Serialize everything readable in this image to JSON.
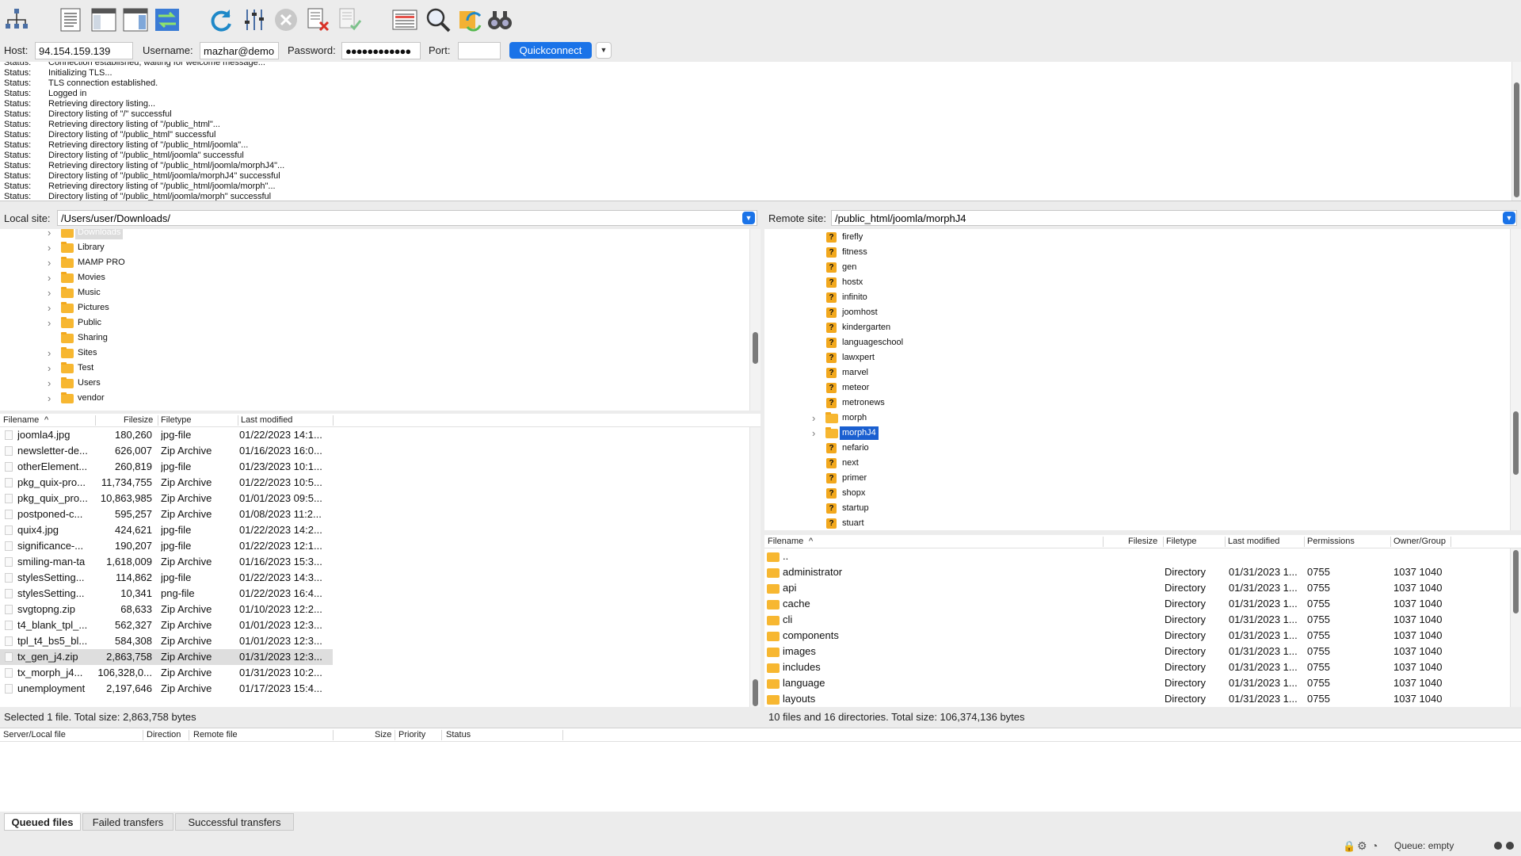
{
  "toolbar": {
    "icons": [
      "site-manager-icon",
      "message-log-icon",
      "local-tree-icon",
      "remote-tree-icon",
      "transfer-queue-icon",
      "refresh-icon",
      "filter-icon",
      "cancel-icon",
      "disconnect-icon",
      "reconnect-icon",
      "directory-comparison-icon",
      "search-icon",
      "sync-browse-icon",
      "find-files-icon"
    ]
  },
  "quickconnect": {
    "host_label": "Host:",
    "host_value": "94.154.159.139",
    "username_label": "Username:",
    "username_value": "mazhar@demo.",
    "password_label": "Password:",
    "password_value": "●●●●●●●●●●●●",
    "port_label": "Port:",
    "port_value": "",
    "button_label": "Quickconnect",
    "dropdown_glyph": "▼"
  },
  "log": [
    {
      "type": "Status:",
      "msg": "Connection established, waiting for welcome message..."
    },
    {
      "type": "Status:",
      "msg": "Initializing TLS..."
    },
    {
      "type": "Status:",
      "msg": "TLS connection established."
    },
    {
      "type": "Status:",
      "msg": "Logged in"
    },
    {
      "type": "Status:",
      "msg": "Retrieving directory listing..."
    },
    {
      "type": "Status:",
      "msg": "Directory listing of \"/\" successful"
    },
    {
      "type": "Status:",
      "msg": "Retrieving directory listing of \"/public_html\"..."
    },
    {
      "type": "Status:",
      "msg": "Directory listing of \"/public_html\" successful"
    },
    {
      "type": "Status:",
      "msg": "Retrieving directory listing of \"/public_html/joomla\"..."
    },
    {
      "type": "Status:",
      "msg": "Directory listing of \"/public_html/joomla\" successful"
    },
    {
      "type": "Status:",
      "msg": "Retrieving directory listing of \"/public_html/joomla/morphJ4\"..."
    },
    {
      "type": "Status:",
      "msg": "Directory listing of \"/public_html/joomla/morphJ4\" successful"
    },
    {
      "type": "Status:",
      "msg": "Retrieving directory listing of \"/public_html/joomla/morph\"..."
    },
    {
      "type": "Status:",
      "msg": "Directory listing of \"/public_html/joomla/morph\" successful"
    }
  ],
  "local": {
    "site_label": "Local site:",
    "path": "/Users/user/Downloads/",
    "tree": [
      {
        "label": "Downloads",
        "expandable": true,
        "state": "dim"
      },
      {
        "label": "Library",
        "expandable": true
      },
      {
        "label": "MAMP PRO",
        "expandable": true
      },
      {
        "label": "Movies",
        "expandable": true
      },
      {
        "label": "Music",
        "expandable": true
      },
      {
        "label": "Pictures",
        "expandable": true
      },
      {
        "label": "Public",
        "expandable": true
      },
      {
        "label": "Sharing",
        "expandable": false
      },
      {
        "label": "Sites",
        "expandable": true
      },
      {
        "label": "Test",
        "expandable": true
      },
      {
        "label": "Users",
        "expandable": true
      },
      {
        "label": "vendor",
        "expandable": true
      }
    ],
    "columns": [
      "Filename",
      "Filesize",
      "Filetype",
      "Last modified"
    ],
    "sort_glyph": "^",
    "files": [
      {
        "name": "joomla4.jpg",
        "size": "180,260",
        "type": "jpg-file",
        "modified": "01/22/2023 14:1..."
      },
      {
        "name": "newsletter-de...",
        "size": "626,007",
        "type": "Zip Archive",
        "modified": "01/16/2023 16:0..."
      },
      {
        "name": "otherElement...",
        "size": "260,819",
        "type": "jpg-file",
        "modified": "01/23/2023 10:1..."
      },
      {
        "name": "pkg_quix-pro...",
        "size": "11,734,755",
        "type": "Zip Archive",
        "modified": "01/22/2023 10:5..."
      },
      {
        "name": "pkg_quix_pro...",
        "size": "10,863,985",
        "type": "Zip Archive",
        "modified": "01/01/2023 09:5..."
      },
      {
        "name": "postponed-c...",
        "size": "595,257",
        "type": "Zip Archive",
        "modified": "01/08/2023 11:2..."
      },
      {
        "name": "quix4.jpg",
        "size": "424,621",
        "type": "jpg-file",
        "modified": "01/22/2023 14:2..."
      },
      {
        "name": "significance-...",
        "size": "190,207",
        "type": "jpg-file",
        "modified": "01/22/2023 12:1..."
      },
      {
        "name": "smiling-man-ta",
        "size": "1,618,009",
        "type": "Zip Archive",
        "modified": "01/16/2023 15:3..."
      },
      {
        "name": "stylesSetting...",
        "size": "114,862",
        "type": "jpg-file",
        "modified": "01/22/2023 14:3..."
      },
      {
        "name": "stylesSetting...",
        "size": "10,341",
        "type": "png-file",
        "modified": "01/22/2023 16:4..."
      },
      {
        "name": "svgtopng.zip",
        "size": "68,633",
        "type": "Zip Archive",
        "modified": "01/10/2023 12:2..."
      },
      {
        "name": "t4_blank_tpl_...",
        "size": "562,327",
        "type": "Zip Archive",
        "modified": "01/01/2023 12:3..."
      },
      {
        "name": "tpl_t4_bs5_bl...",
        "size": "584,308",
        "type": "Zip Archive",
        "modified": "01/01/2023 12:3..."
      },
      {
        "name": "tx_gen_j4.zip",
        "size": "2,863,758",
        "type": "Zip Archive",
        "modified": "01/31/2023 12:3...",
        "selected": true
      },
      {
        "name": "tx_morph_j4...",
        "size": "106,328,0...",
        "type": "Zip Archive",
        "modified": "01/31/2023 10:2..."
      },
      {
        "name": "unemployment",
        "size": "2,197,646",
        "type": "Zip Archive",
        "modified": "01/17/2023 15:4..."
      }
    ],
    "status": "Selected 1 file. Total size: 2,863,758 bytes"
  },
  "remote": {
    "site_label": "Remote site:",
    "path": "/public_html/joomla/morphJ4",
    "tree": [
      {
        "label": "firefly",
        "kind": "unknown"
      },
      {
        "label": "fitness",
        "kind": "unknown"
      },
      {
        "label": "gen",
        "kind": "unknown"
      },
      {
        "label": "hostx",
        "kind": "unknown"
      },
      {
        "label": "infinito",
        "kind": "unknown"
      },
      {
        "label": "joomhost",
        "kind": "unknown"
      },
      {
        "label": "kindergarten",
        "kind": "unknown"
      },
      {
        "label": "languageschool",
        "kind": "unknown"
      },
      {
        "label": "lawxpert",
        "kind": "unknown"
      },
      {
        "label": "marvel",
        "kind": "unknown"
      },
      {
        "label": "meteor",
        "kind": "unknown"
      },
      {
        "label": "metronews",
        "kind": "unknown"
      },
      {
        "label": "morph",
        "kind": "folder",
        "expandable": true
      },
      {
        "label": "morphJ4",
        "kind": "folder",
        "expandable": true,
        "state": "selected"
      },
      {
        "label": "nefario",
        "kind": "unknown"
      },
      {
        "label": "next",
        "kind": "unknown"
      },
      {
        "label": "primer",
        "kind": "unknown"
      },
      {
        "label": "shopx",
        "kind": "unknown"
      },
      {
        "label": "startup",
        "kind": "unknown"
      },
      {
        "label": "stuart",
        "kind": "unknown"
      }
    ],
    "columns": [
      "Filename",
      "Filesize",
      "Filetype",
      "Last modified",
      "Permissions",
      "Owner/Group"
    ],
    "sort_glyph": "^",
    "files": [
      {
        "name": "..",
        "type": "",
        "modified": "",
        "perms": "",
        "owner": ""
      },
      {
        "name": "administrator",
        "type": "Directory",
        "modified": "01/31/2023 1...",
        "perms": "0755",
        "owner": "1037 1040"
      },
      {
        "name": "api",
        "type": "Directory",
        "modified": "01/31/2023 1...",
        "perms": "0755",
        "owner": "1037 1040"
      },
      {
        "name": "cache",
        "type": "Directory",
        "modified": "01/31/2023 1...",
        "perms": "0755",
        "owner": "1037 1040"
      },
      {
        "name": "cli",
        "type": "Directory",
        "modified": "01/31/2023 1...",
        "perms": "0755",
        "owner": "1037 1040"
      },
      {
        "name": "components",
        "type": "Directory",
        "modified": "01/31/2023 1...",
        "perms": "0755",
        "owner": "1037 1040"
      },
      {
        "name": "images",
        "type": "Directory",
        "modified": "01/31/2023 1...",
        "perms": "0755",
        "owner": "1037 1040"
      },
      {
        "name": "includes",
        "type": "Directory",
        "modified": "01/31/2023 1...",
        "perms": "0755",
        "owner": "1037 1040"
      },
      {
        "name": "language",
        "type": "Directory",
        "modified": "01/31/2023 1...",
        "perms": "0755",
        "owner": "1037 1040"
      },
      {
        "name": "layouts",
        "type": "Directory",
        "modified": "01/31/2023 1...",
        "perms": "0755",
        "owner": "1037 1040"
      }
    ],
    "status": "10 files and 16 directories. Total size: 106,374,136 bytes"
  },
  "queue": {
    "columns": [
      "Server/Local file",
      "Direction",
      "Remote file",
      "Size",
      "Priority",
      "Status"
    ],
    "tabs": [
      "Queued files",
      "Failed transfers",
      "Successful transfers"
    ],
    "active_tab": 0
  },
  "statusbar": {
    "queue_text": "Queue: empty",
    "icons": [
      "lock-icon",
      "gear-icon",
      "speed-limit-icon",
      "transfer-indicator-icon"
    ]
  }
}
